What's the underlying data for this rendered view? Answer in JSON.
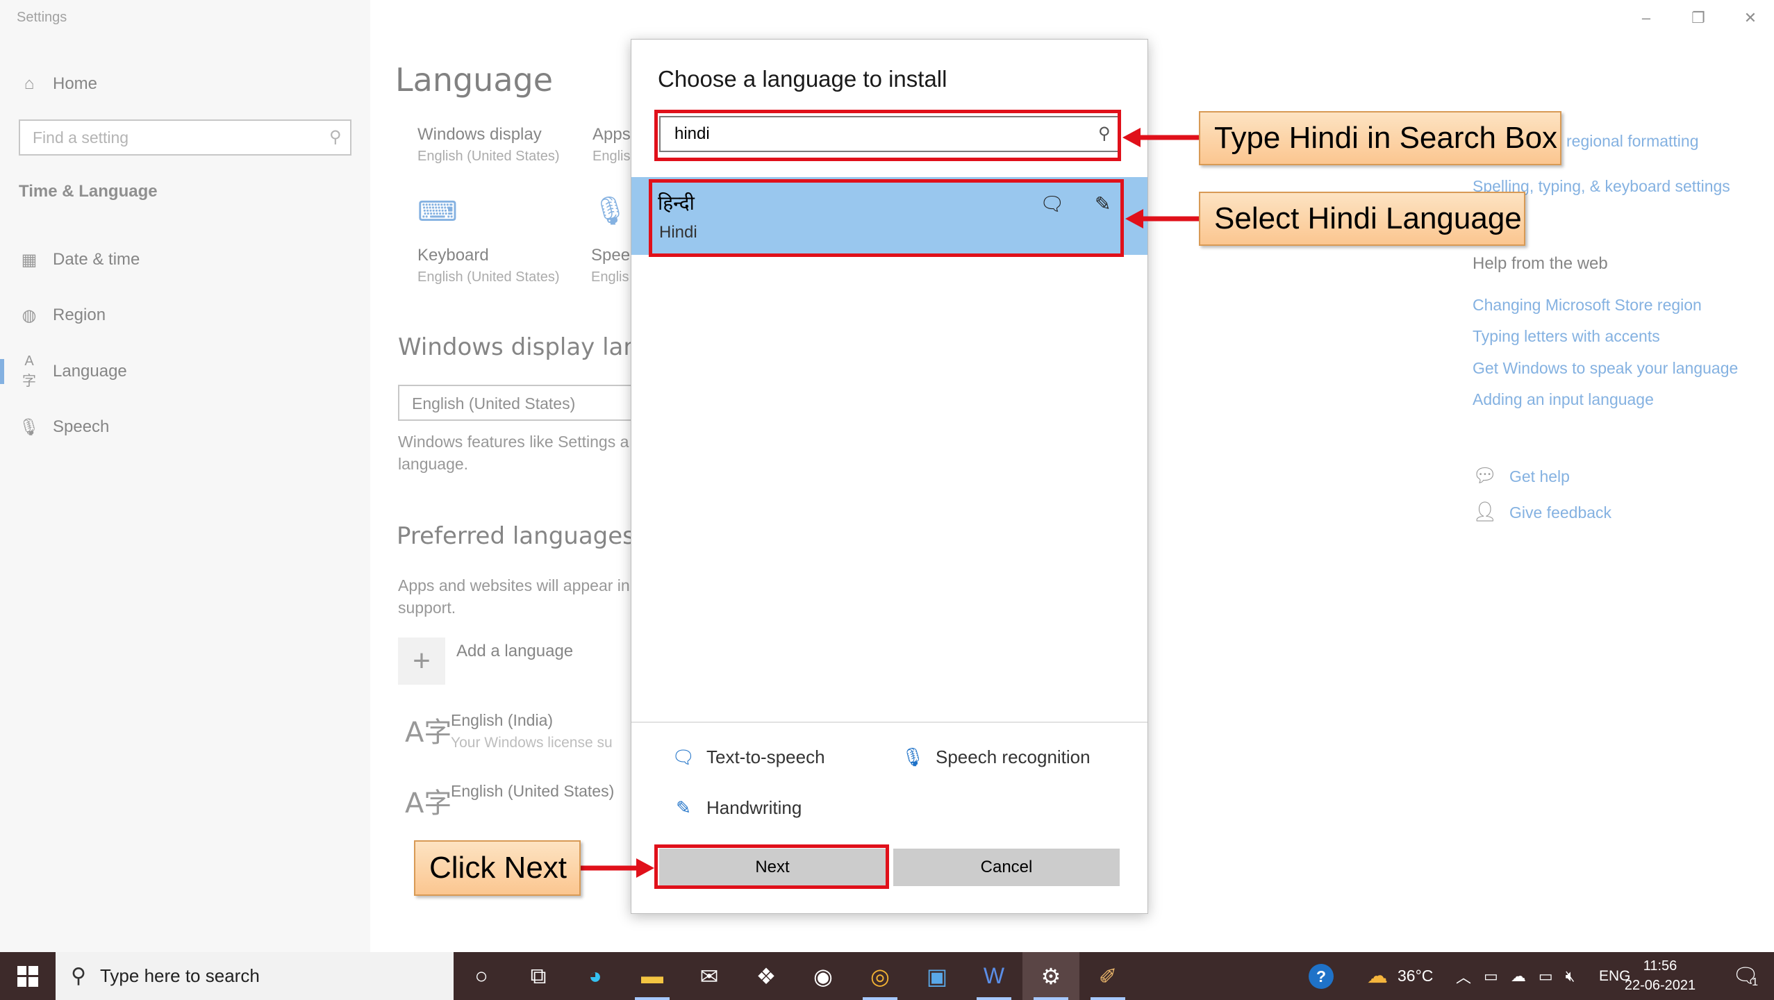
{
  "window": {
    "title": "Settings",
    "controls": {
      "minimize": "–",
      "restore": "❐",
      "close": "✕"
    }
  },
  "sidebar": {
    "home": {
      "label": "Home",
      "icon": "home-icon"
    },
    "search_placeholder": "Find a setting",
    "section": "Time & Language",
    "items": [
      {
        "label": "Date & time",
        "icon": "calendar-clock-icon"
      },
      {
        "label": "Region",
        "icon": "globe-icon"
      },
      {
        "label": "Language",
        "icon": "language-icon",
        "active": true
      },
      {
        "label": "Speech",
        "icon": "microphone-icon"
      }
    ]
  },
  "main": {
    "title": "Language",
    "tiles": [
      {
        "title": "Windows display",
        "sub": "English (United States)"
      },
      {
        "title": "Apps",
        "sub": "Englis"
      },
      {
        "title": "Keyboard",
        "sub": "English (United States)"
      },
      {
        "title": "Speec",
        "sub": "Englis"
      }
    ],
    "display_lang_heading": "Windows display langu",
    "display_lang_value": "English (United States)",
    "display_lang_desc_1": "Windows features like Settings a",
    "display_lang_desc_2": "language.",
    "preferred_heading": "Preferred languages",
    "preferred_desc_1": "Apps and websites will appear in",
    "preferred_desc_2": "support.",
    "add_language": "Add a language",
    "languages": [
      {
        "name": "English (India)",
        "sub": "Your Windows license su"
      },
      {
        "name": "English (United States)",
        "sub": ""
      }
    ]
  },
  "right": {
    "links_top": [
      "regional formatting",
      "Spelling, typing, & keyboard settings"
    ],
    "help_heading": "Help from the web",
    "help_links": [
      "Changing Microsoft Store region",
      "Typing letters with accents",
      "Get Windows to speak your language",
      "Adding an input language"
    ],
    "get_help": "Get help",
    "give_feedback": "Give feedback"
  },
  "dialog": {
    "title": "Choose a language to install",
    "search_value": "hindi",
    "result": {
      "native": "हिन्दी",
      "english": "Hindi"
    },
    "features": {
      "tts": "Text-to-speech",
      "speech": "Speech recognition",
      "handwriting": "Handwriting"
    },
    "next": "Next",
    "cancel": "Cancel"
  },
  "callouts": {
    "search": "Type Hindi in Search Box",
    "select": "Select Hindi Language",
    "next": "Click Next"
  },
  "colors": {
    "accent": "#1f72c8",
    "highlight": "#99c7ee",
    "annotation_red": "#e0101a",
    "callout_fill": "#fbc690",
    "taskbar": "#3d2a2a"
  },
  "taskbar": {
    "search_placeholder": "Type here to search",
    "weather": "36°C",
    "lang": "ENG",
    "time": "11:56",
    "date": "22-06-2021",
    "notifications": "1",
    "apps": [
      "cortana-icon",
      "task-view-icon",
      "edge-icon",
      "file-explorer-icon",
      "mail-icon",
      "dropbox-icon",
      "app-icon",
      "chrome-icon",
      "outlook-icon",
      "word-icon",
      "settings-icon",
      "paint-icon"
    ]
  }
}
